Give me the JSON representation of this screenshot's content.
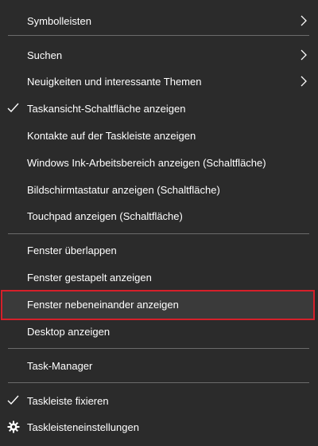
{
  "menu": {
    "items": [
      {
        "label": "Symbolleisten",
        "submenu": true
      },
      {
        "label": "Suchen",
        "submenu": true
      },
      {
        "label": "Neuigkeiten und interessante Themen",
        "submenu": true
      },
      {
        "label": "Taskansicht-Schaltfläche anzeigen",
        "checked": true
      },
      {
        "label": "Kontakte auf der Taskleiste anzeigen"
      },
      {
        "label": "Windows Ink-Arbeitsbereich anzeigen (Schaltfläche)"
      },
      {
        "label": "Bildschirmtastatur anzeigen (Schaltfläche)"
      },
      {
        "label": "Touchpad anzeigen (Schaltfläche)"
      },
      {
        "label": "Fenster überlappen"
      },
      {
        "label": "Fenster gestapelt anzeigen"
      },
      {
        "label": "Fenster nebeneinander anzeigen",
        "highlighted": true
      },
      {
        "label": "Desktop anzeigen"
      },
      {
        "label": "Task-Manager"
      },
      {
        "label": "Taskleiste fixieren",
        "checked": true
      },
      {
        "label": "Taskleisteneinstellungen",
        "icon": "gear-icon"
      }
    ]
  },
  "colors": {
    "background": "#2b2b2b",
    "text": "#ffffff",
    "separator": "#6b6b6b",
    "highlight_border": "#d6202a"
  }
}
